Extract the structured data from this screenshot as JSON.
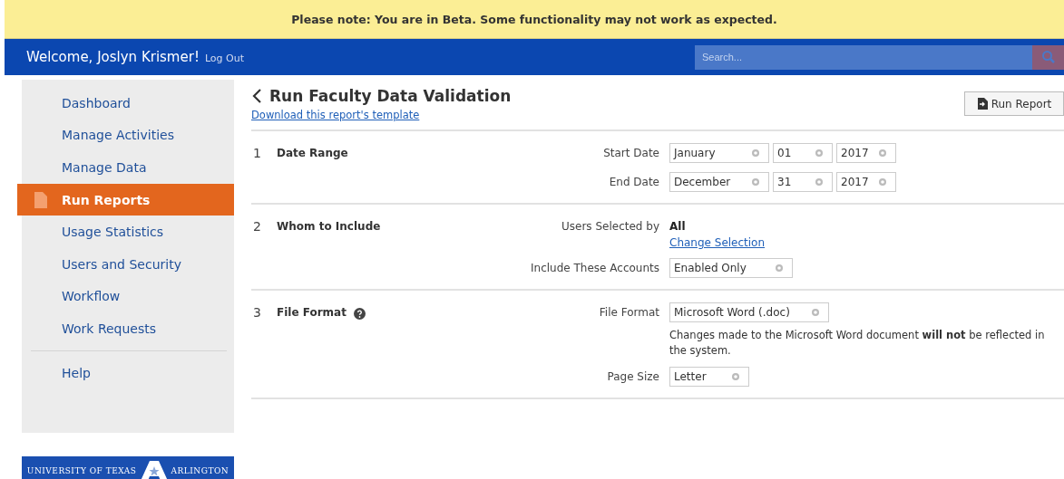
{
  "banner": {
    "text": "Please note: You are in Beta. Some functionality may not work as expected."
  },
  "header": {
    "welcome": "Welcome, Joslyn Krismer!",
    "logout": "Log Out",
    "search": {
      "placeholder": "Search..."
    }
  },
  "sidebar": {
    "items": [
      {
        "label": "Dashboard",
        "selected": false,
        "kind": "nav"
      },
      {
        "label": "Manage Activities",
        "selected": false,
        "kind": "nav"
      },
      {
        "label": "Manage Data",
        "selected": false,
        "kind": "nav"
      },
      {
        "label": "Run Reports",
        "selected": true,
        "kind": "nav"
      },
      {
        "label": "Usage Statistics",
        "selected": false,
        "kind": "nav"
      },
      {
        "label": "Users and Security",
        "selected": false,
        "kind": "nav"
      },
      {
        "label": "Workflow",
        "selected": false,
        "kind": "nav"
      },
      {
        "label": "Work Requests",
        "selected": false,
        "kind": "nav"
      },
      {
        "kind": "divider"
      },
      {
        "label": "Help",
        "selected": false,
        "kind": "nav"
      }
    ],
    "logo": {
      "left": "UNIVERSITY OF TEXAS",
      "right": "ARLINGTON"
    }
  },
  "page": {
    "title": "Run Faculty Data Validation",
    "template_link": "Download this report's template",
    "run_button": "Run Report"
  },
  "sections": [
    {
      "number": "1",
      "title": "Date Range",
      "help": false,
      "rows": [
        {
          "label": "Start Date",
          "kind": "selects",
          "selects": [
            {
              "value": "January"
            },
            {
              "value": "01"
            },
            {
              "value": "2017"
            }
          ]
        },
        {
          "label": "End Date",
          "kind": "selects",
          "selects": [
            {
              "value": "December"
            },
            {
              "value": "31"
            },
            {
              "value": "2017"
            }
          ]
        }
      ]
    },
    {
      "number": "2",
      "title": "Whom to Include",
      "help": false,
      "rows": [
        {
          "label": "Users Selected by",
          "kind": "value",
          "value": "All",
          "link": "Change Selection"
        },
        {
          "label": "Include These Accounts",
          "kind": "selects",
          "selects": [
            {
              "value": "Enabled Only"
            }
          ]
        }
      ]
    },
    {
      "number": "3",
      "title": "File Format",
      "help": true,
      "rows": [
        {
          "label": "File Format",
          "kind": "selects",
          "selects": [
            {
              "value": "Microsoft Word (.doc)"
            }
          ],
          "note": "Changes made to the Microsoft Word document **will not** be reflected in the system."
        },
        {
          "label": "Page Size",
          "kind": "selects",
          "selects": [
            {
              "value": "Letter"
            }
          ]
        }
      ]
    }
  ]
}
